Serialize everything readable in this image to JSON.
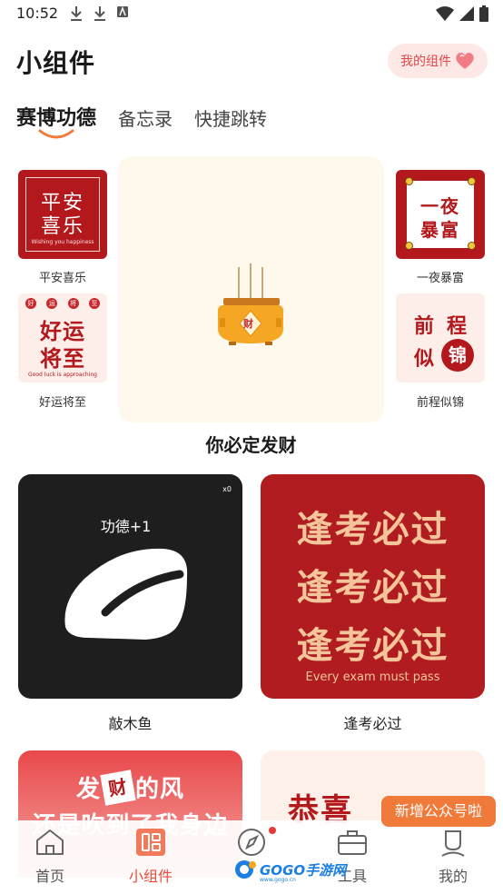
{
  "status_bar": {
    "time": "10:52"
  },
  "header": {
    "title": "小组件",
    "my_widgets_label": "我的组件"
  },
  "tabs": [
    {
      "label": "赛博功德",
      "active": true
    },
    {
      "label": "备忘录",
      "active": false
    },
    {
      "label": "快捷跳转",
      "active": false
    }
  ],
  "widgets_row": {
    "pingan": {
      "line1": "平安",
      "line2": "喜乐",
      "subtitle": "Wishing you happiness",
      "label": "平安喜乐"
    },
    "haoyun": {
      "dots": [
        "好",
        "运",
        "将",
        "至"
      ],
      "line1": "好运",
      "line2": "将至",
      "subtitle": "Good luck is approaching",
      "label": "好运将至"
    },
    "big": {
      "burner_char": "财",
      "caption": "你必定发财"
    },
    "yiye": {
      "line1": "一夜",
      "line2": "暴富",
      "label": "一夜暴富"
    },
    "qiancheng": {
      "c1": "前",
      "c2": "程",
      "c3": "似",
      "c4": "锦",
      "label": "前程似锦"
    }
  },
  "muyu": {
    "count": "x0",
    "merit_text": "功德+1",
    "label": "敲木鱼"
  },
  "kaoshi": {
    "line": "逢考必过",
    "subtitle": "Every exam must pass",
    "label": "逢考必过"
  },
  "facai": {
    "line1": "发",
    "box_char": "财",
    "line1_rest": "的风",
    "line2": "还是吹到了我身边"
  },
  "gongxi": {
    "text": "恭喜"
  },
  "promo": "新增公众号啦",
  "watermark": {
    "text": "GOGO手游网",
    "sub": "www.gogo.cn"
  },
  "nav": [
    {
      "label": "首页",
      "active": false
    },
    {
      "label": "小组件",
      "active": true
    },
    {
      "label": "",
      "active": false
    },
    {
      "label": "工具",
      "active": false
    },
    {
      "label": "我的",
      "active": false
    }
  ],
  "colors": {
    "accent": "#e94b3c",
    "festive_red": "#b3191c",
    "gold": "#f4c59a",
    "promo": "#f07a3a"
  }
}
